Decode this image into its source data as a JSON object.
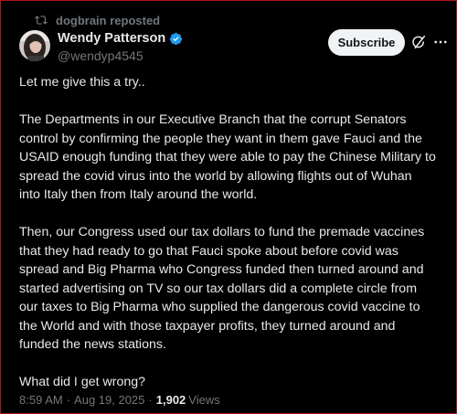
{
  "repost": {
    "label": "dogbrain reposted",
    "icon": "repost-icon"
  },
  "author": {
    "display_name": "Wendy Patterson",
    "handle": "@wendyp4545",
    "verified_color": "#1d9bf0",
    "avatar_icon": "profile-photo"
  },
  "actions": {
    "subscribe_label": "Subscribe",
    "grok_icon": "grok-icon",
    "more_icon": "more-options-icon"
  },
  "tweet": {
    "lines": [
      "Let me give this a try..",
      "",
      "The Departments in our Executive Branch that the corrupt Senators",
      "control by confirming the people they want in them gave Fauci and the",
      "USAID enough funding that they were able to pay the Chinese Military to",
      "spread the covid virus into the world by allowing flights out of Wuhan",
      "into Italy then from Italy around the world.",
      "",
      "Then, our Congress used our tax dollars to fund the premade vaccines",
      "that they had ready to go that Fauci spoke about before covid was",
      "spread and Big Pharma who Congress funded then turned around and",
      "started advertising on TV so our tax dollars did a complete circle from",
      "our taxes to Big Pharma who supplied the dangerous covid vaccine to",
      "the World and with those taxpayer profits, they turned around and",
      "funded the news stations.",
      "",
      "What did I get wrong?"
    ]
  },
  "meta": {
    "time": "8:59 AM",
    "separator": "·",
    "date": "Aug 19, 2025",
    "views_count": "1,902",
    "views_label": "Views"
  },
  "colors": {
    "background": "#000000",
    "text": "#e7e9ea",
    "secondary": "#71767b",
    "frame_border": "#b3121d"
  }
}
